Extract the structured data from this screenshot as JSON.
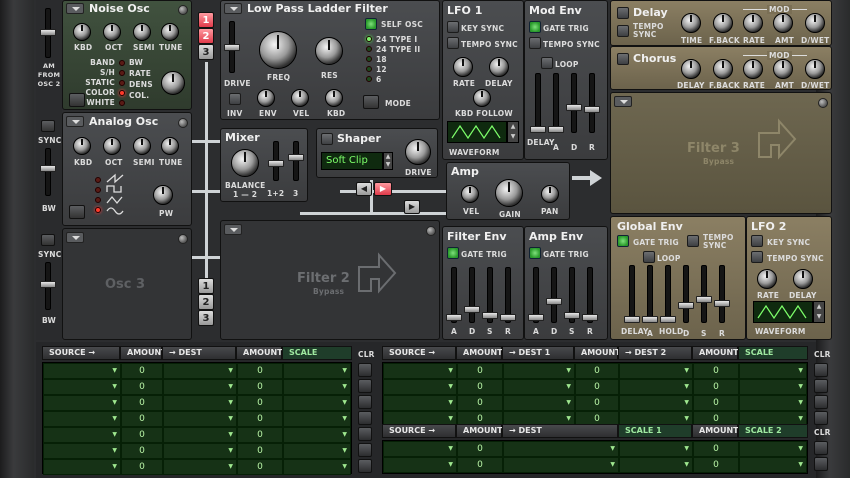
{
  "rack": {
    "am_from_osc2": "AM FROM OSC 2",
    "sync": "SYNC",
    "bw": "BW"
  },
  "noise_osc": {
    "title": "Noise Osc",
    "kbd": "KBD",
    "oct": "OCT",
    "semi": "SEMI",
    "tune": "TUNE",
    "modes": [
      "BAND",
      "S/H",
      "STATIC",
      "COLOR",
      "WHITE"
    ],
    "bw": "BW",
    "rate": "RATE",
    "dens": "DENS",
    "col": "COL."
  },
  "analog_osc": {
    "title": "Analog Osc",
    "kbd": "KBD",
    "oct": "OCT",
    "semi": "SEMI",
    "tune": "TUNE",
    "pw": "PW"
  },
  "osc3": {
    "title": "Osc 3"
  },
  "filter1": {
    "title": "Low Pass Ladder Filter",
    "self_osc": "SELF OSC",
    "types": [
      "24 TYPE I",
      "24 TYPE II",
      "18",
      "12",
      "6"
    ],
    "drive": "DRIVE",
    "freq": "FREQ",
    "res": "RES",
    "inv": "INV",
    "env": "ENV",
    "vel": "VEL",
    "kbd": "KBD",
    "mode": "MODE"
  },
  "routing_top": [
    "1",
    "2",
    "3"
  ],
  "routing_bottom": [
    "1",
    "2",
    "3"
  ],
  "mixer": {
    "title": "Mixer",
    "balance": "BALANCE",
    "balance_sub": "1 — 2",
    "ch12": "1+2",
    "ch3": "3"
  },
  "shaper": {
    "title": "Shaper",
    "mode": "Soft Clip",
    "drive": "DRIVE"
  },
  "amp": {
    "title": "Amp",
    "vel": "VEL",
    "gain": "GAIN",
    "pan": "PAN"
  },
  "filter2": {
    "title": "Filter 2",
    "sub": "Bypass"
  },
  "filter3": {
    "title": "Filter 3",
    "sub": "Bypass"
  },
  "lfo1": {
    "title": "LFO 1",
    "key_sync": "KEY SYNC",
    "tempo_sync": "TEMPO SYNC",
    "rate": "RATE",
    "delay": "DELAY",
    "kbd_follow": "KBD FOLLOW",
    "waveform": "WAVEFORM"
  },
  "mod_env": {
    "title": "Mod Env",
    "gate_trig": "GATE TRIG",
    "tempo_sync": "TEMPO SYNC",
    "loop": "LOOP",
    "delay": "DELAY",
    "a": "A",
    "d": "D",
    "r": "R"
  },
  "filter_env": {
    "title": "Filter Env",
    "gate_trig": "GATE TRIG",
    "a": "A",
    "d": "D",
    "s": "S",
    "r": "R"
  },
  "amp_env": {
    "title": "Amp Env",
    "gate_trig": "GATE TRIG",
    "a": "A",
    "d": "D",
    "s": "S",
    "r": "R"
  },
  "delay": {
    "title": "Delay",
    "tempo_sync": "TEMPO SYNC",
    "mod": "MOD",
    "time": "TIME",
    "fback": "F.BACK",
    "rate": "RATE",
    "amt": "AMT",
    "dwet": "D/WET"
  },
  "chorus": {
    "title": "Chorus",
    "mod": "MOD",
    "delay": "DELAY",
    "fback": "F.BACK",
    "rate": "RATE",
    "amt": "AMT",
    "dwet": "D/WET"
  },
  "global_env": {
    "title": "Global Env",
    "gate_trig": "GATE TRIG",
    "tempo_sync": "TEMPO SYNC",
    "loop": "LOOP",
    "delay": "DELAY",
    "a": "A",
    "hold": "HOLD",
    "d": "D",
    "s": "S",
    "r": "R"
  },
  "lfo2": {
    "title": "LFO 2",
    "key_sync": "KEY SYNC",
    "tempo_sync": "TEMPO SYNC",
    "rate": "RATE",
    "delay": "DELAY",
    "waveform": "WAVEFORM"
  },
  "mod_bus1": {
    "headers": [
      "SOURCE →",
      "AMOUNT",
      "→ DEST",
      "AMOUNT",
      "SCALE"
    ],
    "clr": "CLR",
    "rows": 7,
    "amount_value": "0"
  },
  "mod_bus2": {
    "headers": [
      "SOURCE →",
      "AMOUNT",
      "→ DEST 1",
      "AMOUNT",
      "→ DEST 2",
      "AMOUNT",
      "SCALE"
    ],
    "clr": "CLR",
    "rows": 4,
    "amount_value": "0"
  },
  "mod_bus3": {
    "headers": [
      "SOURCE →",
      "AMOUNT",
      "→ DEST",
      "SCALE 1",
      "AMOUNT",
      "SCALE 2"
    ],
    "clr": "CLR",
    "rows": 2,
    "amount_value": "0"
  },
  "colors": {
    "panel": "#3b3c3e",
    "green_panel": "#2f3b2d",
    "tan_panel": "#6c634c",
    "display": "#0f2a0f",
    "led_green": "#7cf26c",
    "led_red": "#ff3a2a",
    "accent_pink": "#e03a4a"
  }
}
